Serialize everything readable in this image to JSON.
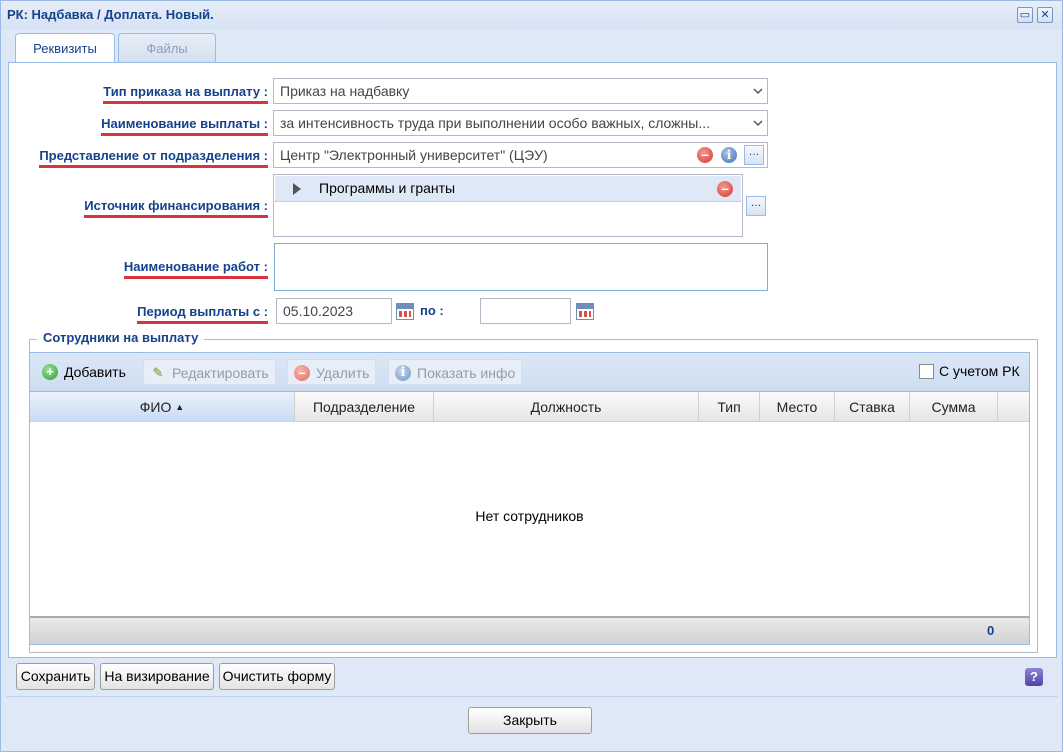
{
  "window": {
    "title": "РК: Надбавка / Доплата. Новый."
  },
  "tabs": [
    {
      "label": "Реквизиты"
    },
    {
      "label": "Файлы"
    }
  ],
  "form": {
    "order_type": {
      "label": "Тип приказа на выплату :",
      "value": "Приказ на надбавку"
    },
    "payment_name": {
      "label": "Наименование выплаты :",
      "value": "за интенсивность труда при выполнении особо важных, сложны..."
    },
    "department": {
      "label": "Представление от подразделения :",
      "value": "Центр \"Электронный университет\" (ЦЭУ)"
    },
    "funding": {
      "label": "Источник финансирования :",
      "items": [
        "Программы и гранты"
      ]
    },
    "work_name": {
      "label": "Наименование работ :",
      "value": ""
    },
    "period": {
      "label": "Период выплаты с :",
      "from": "05.10.2023",
      "to_label": "по :",
      "to": ""
    }
  },
  "employees": {
    "legend": "Сотрудники на выплату",
    "toolbar": {
      "add": "Добавить",
      "edit": "Редактировать",
      "delete": "Удалить",
      "info": "Показать инфо",
      "with_rk": "С учетом РК"
    },
    "columns": [
      "ФИО",
      "Подразделение",
      "Должность",
      "Тип",
      "Место",
      "Ставка",
      "Сумма"
    ],
    "empty_text": "Нет сотрудников",
    "total": "0"
  },
  "buttons": {
    "save": "Сохранить",
    "to_approval": "На визирование",
    "clear": "Очистить форму",
    "close": "Закрыть",
    "help": "?"
  },
  "colors": {
    "accent": "#15428b",
    "underline": "#d9333f",
    "border": "#99bbe8"
  }
}
